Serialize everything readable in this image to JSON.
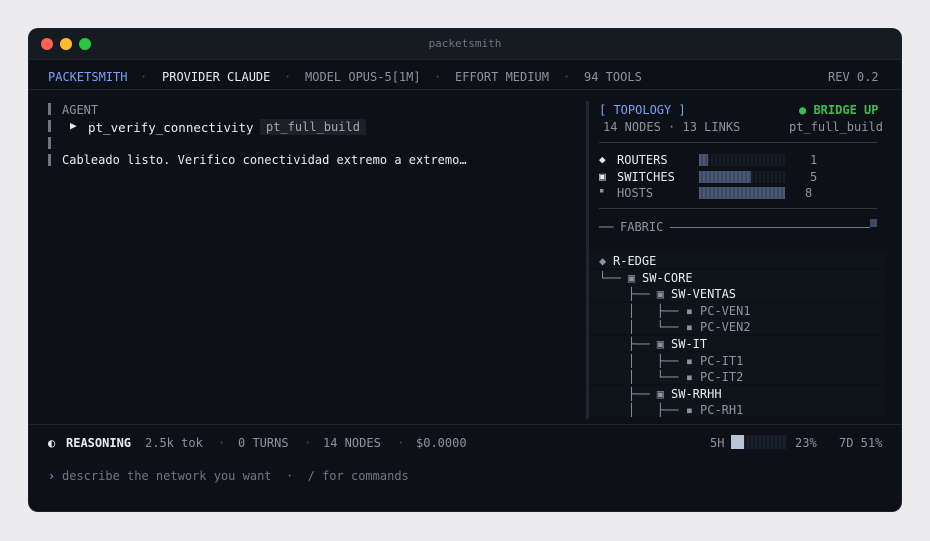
{
  "window": {
    "title": "packetsmith"
  },
  "status_bar": {
    "app": "PACKETSMITH",
    "provider": "PROVIDER CLAUDE",
    "model": "MODEL OPUS-5[1M]",
    "effort": "EFFORT MEDIUM",
    "tools": "94 TOOLS",
    "rev": "REV 0.2"
  },
  "agent": {
    "label": "AGENT",
    "active_tool": "pt_verify_connectivity",
    "tool_chip": "pt_full_build",
    "message": "Cableado listo. Verifico conectividad extremo a extremo…"
  },
  "topology": {
    "title": "[ TOPOLOGY ]",
    "bridge_status": "● BRIDGE UP",
    "summary": "14 NODES · 13 LINKS",
    "build_name": "pt_full_build",
    "counts": [
      {
        "glyph": "◆",
        "label": "ROUTERS",
        "value": "1",
        "fraction": 0.1
      },
      {
        "glyph": "▣",
        "label": "SWITCHES",
        "value": "5",
        "fraction": 0.6
      },
      {
        "glyph": "▪",
        "label": "HOSTS",
        "value": "8",
        "fraction": 1.0
      }
    ],
    "fabric_label": "FABRIC",
    "tree": [
      {
        "prefix": "◆ ",
        "name": "R-EDGE"
      },
      {
        "prefix": "└── ▣ ",
        "name": "SW-CORE"
      },
      {
        "prefix": "    ├── ▣ ",
        "name": "SW-VENTAS"
      },
      {
        "prefix": "    │   ├── ▪ ",
        "name": "PC-VEN1"
      },
      {
        "prefix": "    │   └── ▪ ",
        "name": "PC-VEN2"
      },
      {
        "prefix": "    ├── ▣ ",
        "name": "SW-IT"
      },
      {
        "prefix": "    │   ├── ▪ ",
        "name": "PC-IT1"
      },
      {
        "prefix": "    │   └── ▪ ",
        "name": "PC-IT2"
      },
      {
        "prefix": "    ├── ▣ ",
        "name": "SW-RRHH"
      },
      {
        "prefix": "    │   ├── ▪ ",
        "name": "PC-RH1"
      }
    ]
  },
  "footer": {
    "reasoning_icon": "◐",
    "reasoning": "REASONING",
    "tokens": "2.5k tok",
    "turns": "0 TURNS",
    "nodes": "14 NODES",
    "cost": "$0.0000",
    "usage_5h_label": "5H",
    "usage_5h_pct": "23%",
    "usage_5h_fraction": 0.23,
    "usage_7d": "7D 51%"
  },
  "prompt": {
    "caret": "›",
    "placeholder": "describe the network you want  ·  / for commands"
  },
  "colors": {
    "accent": "#7aa2f7",
    "status_up": "#3fb950",
    "background": "#0d1117"
  }
}
